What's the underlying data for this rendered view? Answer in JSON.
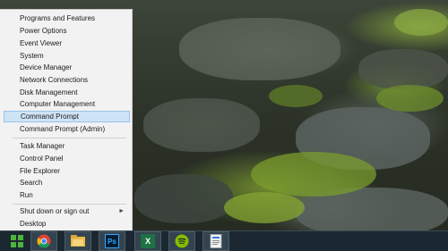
{
  "menu": {
    "items": [
      {
        "label": "Programs and Features"
      },
      {
        "label": "Power Options"
      },
      {
        "label": "Event Viewer"
      },
      {
        "label": "System"
      },
      {
        "label": "Device Manager"
      },
      {
        "label": "Network Connections"
      },
      {
        "label": "Disk Management"
      },
      {
        "label": "Computer Management"
      },
      {
        "label": "Command Prompt"
      },
      {
        "label": "Command Prompt (Admin)"
      },
      {
        "label": "Task Manager"
      },
      {
        "label": "Control Panel"
      },
      {
        "label": "File Explorer"
      },
      {
        "label": "Search"
      },
      {
        "label": "Run"
      },
      {
        "label": "Shut down or sign out"
      },
      {
        "label": "Desktop"
      }
    ],
    "selected_label": "Command Prompt"
  },
  "taskbar": {
    "apps": [
      {
        "icon": "chrome-icon"
      },
      {
        "icon": "file-explorer-icon"
      },
      {
        "icon": "photoshop-icon",
        "text": "Ps"
      },
      {
        "icon": "excel-icon",
        "text": "X"
      },
      {
        "icon": "spotify-icon"
      },
      {
        "icon": "document-app-icon"
      }
    ]
  },
  "colors": {
    "menu_bg": "#f2f2f2",
    "selection": "#cfe3f6",
    "taskbar": "#1b2731",
    "start_green": "#4cb63a"
  }
}
